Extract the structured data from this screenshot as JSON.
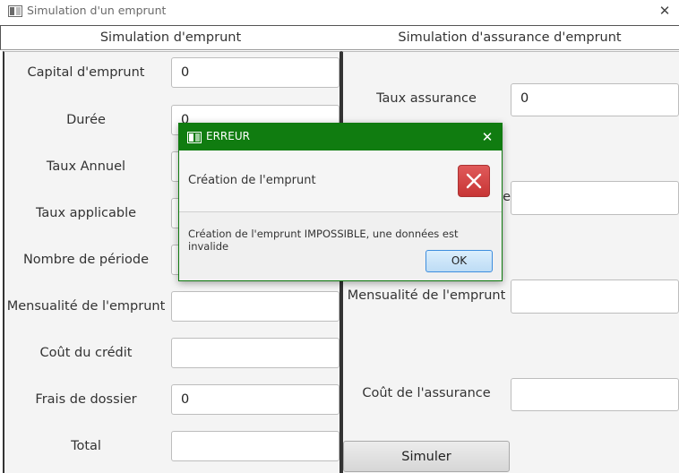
{
  "window": {
    "title": "Simulation d'un emprunt"
  },
  "left_panel": {
    "title": "Simulation d'emprunt",
    "fields": [
      {
        "label": "Capital d'emprunt",
        "value": "0"
      },
      {
        "label": "Durée",
        "value": "0"
      },
      {
        "label": "Taux Annuel",
        "value": ""
      },
      {
        "label": "Taux applicable",
        "value": ""
      },
      {
        "label": "Nombre de période",
        "value": ""
      },
      {
        "label": "Mensualité de l'emprunt",
        "value": ""
      },
      {
        "label": "Coût du crédit",
        "value": ""
      },
      {
        "label": "Frais de dossier",
        "value": "0"
      },
      {
        "label": "Total",
        "value": ""
      }
    ]
  },
  "right_panel": {
    "title": "Simulation d'assurance d'emprunt",
    "fields": [
      {
        "label": "Taux assurance",
        "value": "0"
      },
      {
        "label": "e",
        "value": ""
      },
      {
        "label": "Mensualité de l'emprunt",
        "value": ""
      },
      {
        "label": "Coût de l'assurance",
        "value": ""
      }
    ],
    "submit_label": "Simuler"
  },
  "dialog": {
    "title": "ERREUR",
    "header_text": "Création de l'emprunt",
    "content_text": "Création de l'emprunt IMPOSSIBLE, une données est invalide",
    "ok_label": "OK",
    "titlebar_color": "#107c10",
    "error_color": "#d64541"
  }
}
